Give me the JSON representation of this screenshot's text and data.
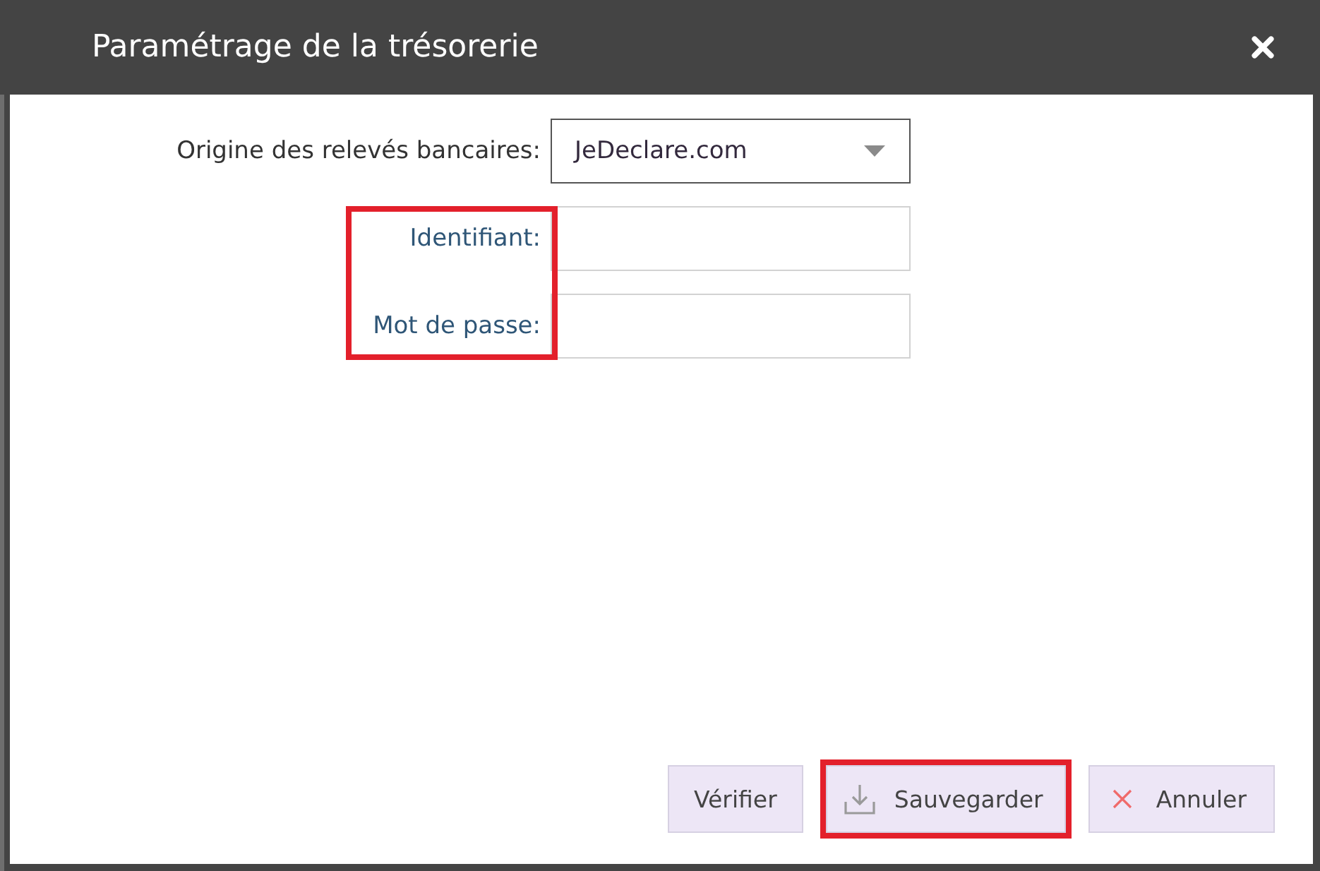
{
  "dialog": {
    "title": "Paramétrage de la trésorerie"
  },
  "fields": [
    {
      "kind": "select",
      "label": "Origine des relevés bancaires:",
      "value": "JeDeclare.com"
    }
  ],
  "credentials": {
    "highlighted": true,
    "fields": [
      {
        "label": "Identifiant:"
      },
      {
        "label": "Mot de passe:"
      }
    ]
  },
  "buttons": [
    {
      "kind": "verify",
      "label": "Vérifier",
      "highlighted": false
    },
    {
      "kind": "save",
      "label": "Sauvegarder",
      "highlighted": true
    },
    {
      "kind": "cancel",
      "label": "Annuler",
      "highlighted": false
    }
  ]
}
